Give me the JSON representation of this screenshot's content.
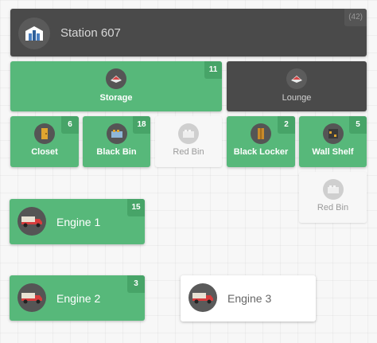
{
  "station": {
    "title": "Station 607",
    "count": "(42)",
    "icon": "building-icon"
  },
  "rooms": [
    {
      "label": "Storage",
      "count": "11",
      "icon": "room-icon",
      "state": "green"
    },
    {
      "label": "Lounge",
      "count": "",
      "icon": "room-icon",
      "state": "dark"
    }
  ],
  "containers": [
    {
      "label": "Closet",
      "count": "6",
      "icon": "door-icon",
      "state": "green"
    },
    {
      "label": "Black Bin",
      "count": "18",
      "icon": "bin-icon",
      "state": "green"
    },
    {
      "label": "Red Bin",
      "count": "",
      "icon": "bin-icon",
      "state": "inactive"
    },
    {
      "label": "Black Locker",
      "count": "2",
      "icon": "locker-icon",
      "state": "green"
    },
    {
      "label": "Wall Shelf",
      "count": "5",
      "icon": "shelf-icon",
      "state": "green"
    },
    {
      "label": "Red Bin",
      "count": "",
      "icon": "bin-icon",
      "state": "inactive"
    }
  ],
  "engines": [
    {
      "label": "Engine 1",
      "count": "15",
      "icon": "truck-icon",
      "state": "green"
    },
    {
      "label": "Engine 2",
      "count": "3",
      "icon": "truck-icon",
      "state": "green"
    },
    {
      "label": "Engine 3",
      "count": "",
      "icon": "truck-icon",
      "state": "inactive"
    }
  ],
  "colors": {
    "green": "#57b87a",
    "dark": "#4a4a4a",
    "inactive": "#f7f7f7"
  }
}
